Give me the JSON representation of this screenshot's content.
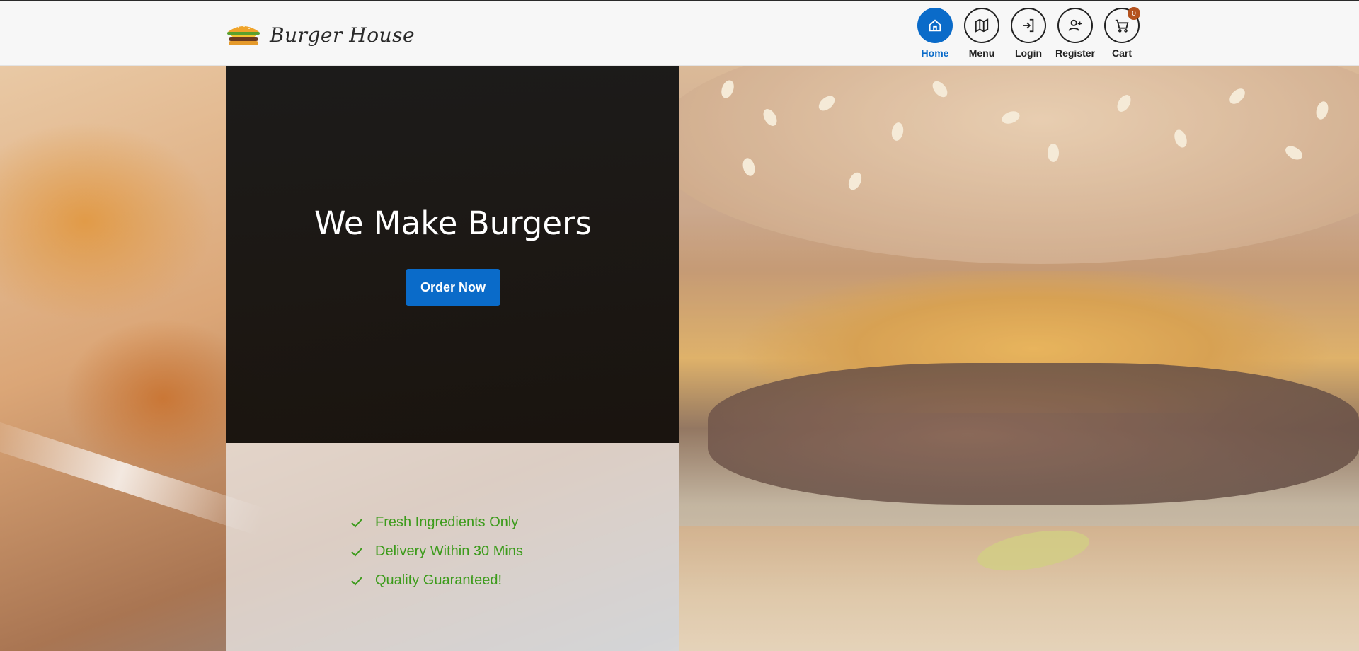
{
  "brand": {
    "name": "Burger House",
    "logo_icon": "burger-icon"
  },
  "nav": {
    "items": [
      {
        "label": "Home",
        "icon": "home-icon",
        "active": true
      },
      {
        "label": "Menu",
        "icon": "map-icon",
        "active": false
      },
      {
        "label": "Login",
        "icon": "login-icon",
        "active": false
      },
      {
        "label": "Register",
        "icon": "user-plus-icon",
        "active": false
      },
      {
        "label": "Cart",
        "icon": "cart-icon",
        "active": false,
        "badge": "0"
      }
    ]
  },
  "hero": {
    "title": "We Make Burgers",
    "cta_label": "Order Now"
  },
  "features": [
    "Fresh Ingredients Only",
    "Delivery Within 30 Mins",
    "Quality Guaranteed!"
  ],
  "colors": {
    "accent": "#0a6bc9",
    "feature_green": "#3c9b1b",
    "badge": "#b4521e",
    "panel_dark": "#161616"
  }
}
